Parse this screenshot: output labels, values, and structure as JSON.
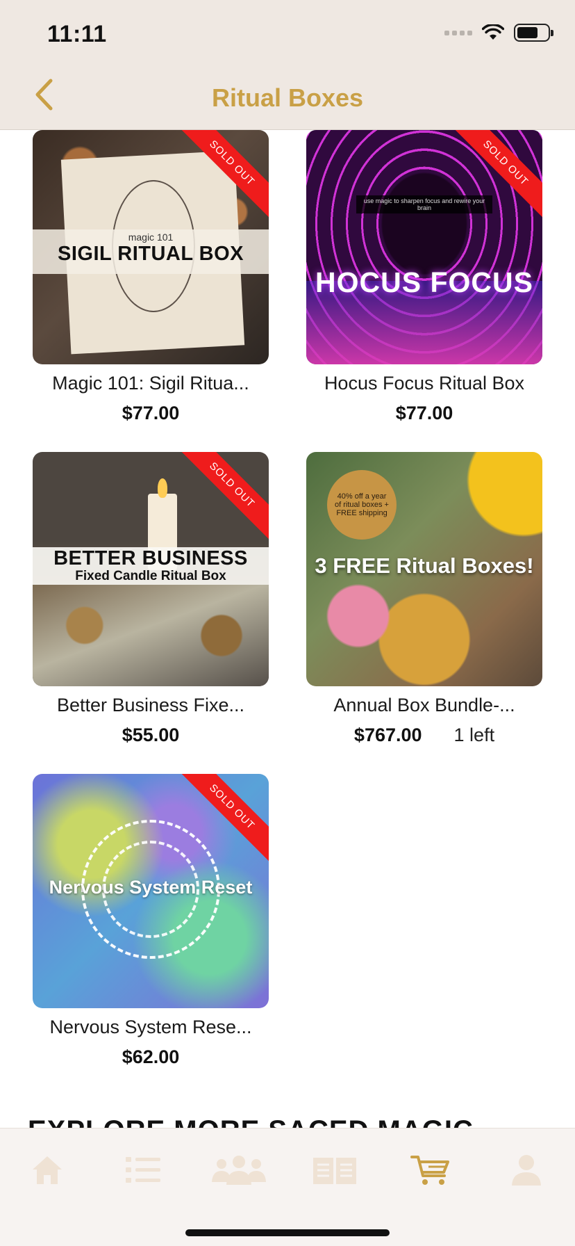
{
  "status_bar": {
    "time": "11:11"
  },
  "header": {
    "title": "Ritual Boxes"
  },
  "products": [
    {
      "name": "Magic 101: Sigil Ritua...",
      "price": "$77.00",
      "badge": "SOLD OUT",
      "image_text": {
        "small": "magic 101",
        "big": "SIGIL RITUAL BOX"
      }
    },
    {
      "name": "Hocus Focus Ritual Box",
      "price": "$77.00",
      "badge": "SOLD OUT",
      "image_text": {
        "tag": "use magic to sharpen focus and rewire your brain",
        "big": "HOCUS FOCUS"
      }
    },
    {
      "name": "Better Business Fixe...",
      "price": "$55.00",
      "badge": "SOLD OUT",
      "image_text": {
        "big": "BETTER BUSINESS",
        "small": "Fixed Candle Ritual Box"
      }
    },
    {
      "name": "Annual Box Bundle-...",
      "price": "$767.00",
      "stock": "1 left",
      "image_text": {
        "badge": "40% off a year of ritual boxes + FREE shipping",
        "big": "3 FREE Ritual Boxes!"
      }
    },
    {
      "name": "Nervous System Rese...",
      "price": "$62.00",
      "badge": "SOLD OUT",
      "image_text": {
        "big": "Nervous System Reset"
      }
    }
  ],
  "section_peek": "EXPLORE MORE SACED MAGIC",
  "tabbar": {
    "tabs": [
      {
        "name": "home",
        "icon": "home-icon"
      },
      {
        "name": "list",
        "icon": "list-icon"
      },
      {
        "name": "community",
        "icon": "community-icon"
      },
      {
        "name": "book",
        "icon": "book-icon"
      },
      {
        "name": "cart",
        "icon": "cart-icon",
        "active": true
      },
      {
        "name": "profile",
        "icon": "profile-icon"
      }
    ]
  },
  "colors": {
    "accent": "#c9a046",
    "tab_inactive": "#efe2d4",
    "ribbon": "#ef1c1c",
    "header_bg": "#efe8e2"
  }
}
